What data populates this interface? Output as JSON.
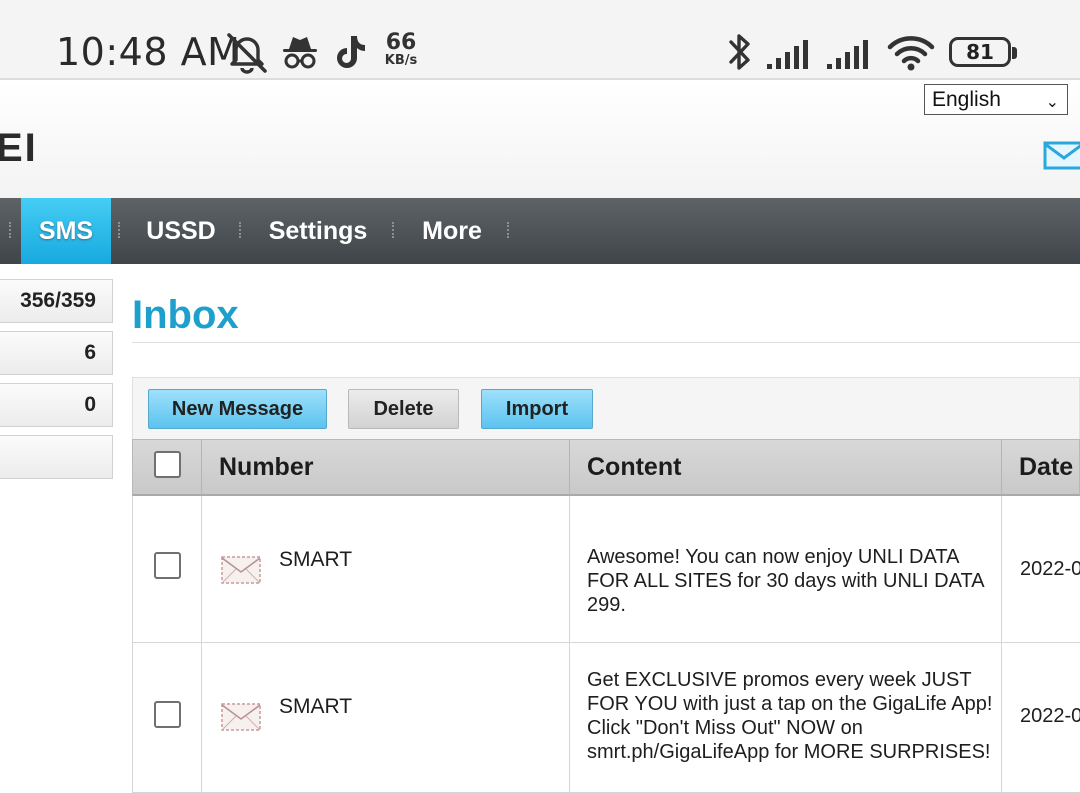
{
  "status_bar": {
    "time": "10:48 AM",
    "net_speed_value": "66",
    "net_speed_unit": "KB/s",
    "battery": "81",
    "icons": [
      "muted-bell-icon",
      "incognito-icon",
      "tiktok-icon",
      "bluetooth-icon",
      "signal-1-icon",
      "signal-2-icon",
      "wifi-icon",
      "battery-icon"
    ]
  },
  "header": {
    "brand_fragment": "EI",
    "language": "English"
  },
  "nav": {
    "items": [
      {
        "label": "SMS",
        "active": true
      },
      {
        "label": "USSD",
        "active": false
      },
      {
        "label": "Settings",
        "active": false
      },
      {
        "label": "More",
        "active": false
      }
    ]
  },
  "sidebar": {
    "counts": [
      "356/359",
      "6",
      "0",
      ""
    ]
  },
  "main": {
    "title": "Inbox",
    "toolbar": {
      "new_message": "New Message",
      "delete": "Delete",
      "import": "Import"
    },
    "table": {
      "headers": {
        "number": "Number",
        "content": "Content",
        "date": "Date"
      },
      "rows": [
        {
          "number": "SMART",
          "content": "Awesome! You can now enjoy UNLI DATA FOR ALL SITES for 30 days with UNLI DATA 299.",
          "date": "2022-0"
        },
        {
          "number": "SMART",
          "content": "Get EXCLUSIVE promos every week JUST FOR YOU with just a tap on the GigaLife App! Click \"Don't Miss Out\" NOW on smrt.ph/GigaLifeApp for MORE SURPRISES!",
          "date": "2022-0"
        }
      ]
    }
  },
  "colors": {
    "accent": "#1fa0cc",
    "nav_active": "#27b6e8",
    "nav_bg": "#4b5154",
    "button_blue": "#7dd3f6"
  }
}
